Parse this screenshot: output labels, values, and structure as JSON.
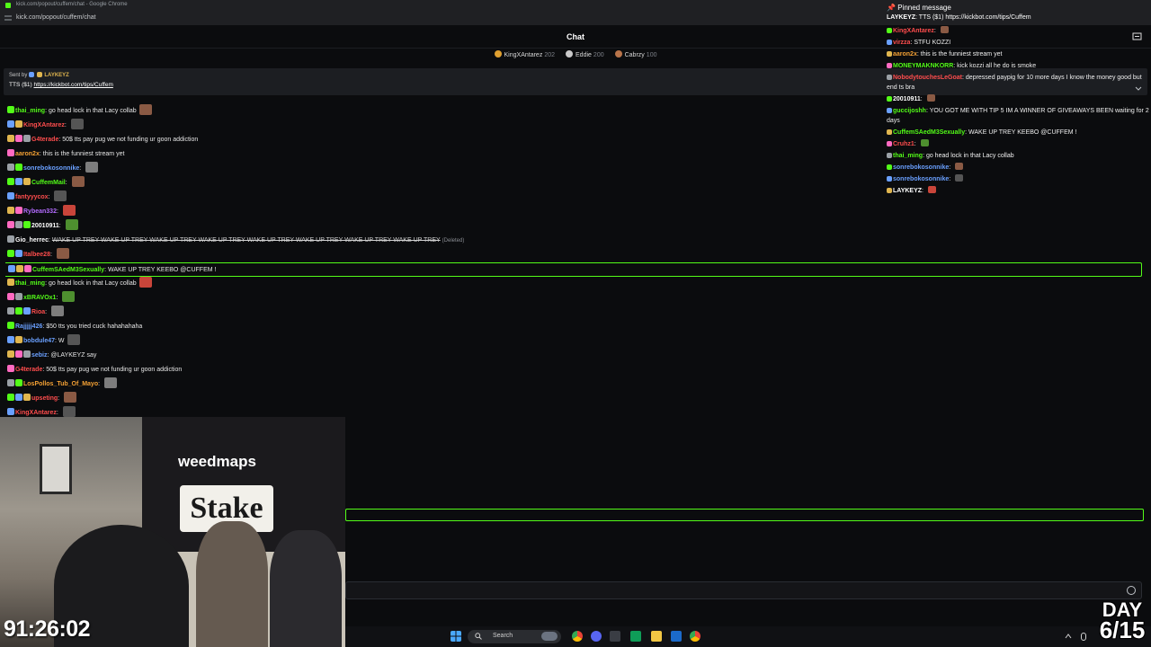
{
  "browser": {
    "title": "kick.com/popout/cuffem/chat - Google Chrome",
    "url": "kick.com/popout/cuffem/chat"
  },
  "chat_header": {
    "title": "Chat"
  },
  "top_gifters": [
    {
      "name": "KingXAntarez",
      "count": "202",
      "color": "#e0a030"
    },
    {
      "name": "Eddie",
      "count": "200",
      "color": "#c9c9c9"
    },
    {
      "name": "Cabrzy",
      "count": "100",
      "color": "#b8744a"
    }
  ],
  "tts": {
    "sent_by_label": "Sent by",
    "sender": "LAYKEYZ",
    "message": "TTS ($1)",
    "link": "https://kickbot.com/tips/Cuffem"
  },
  "messages": [
    {
      "user": "thai_ming",
      "color": "#53fc18",
      "text": "go head lock in that Lacy collab",
      "deleted": false
    },
    {
      "user": "KingXAntarez",
      "color": "#ff4d4d",
      "text": "",
      "deleted": false
    },
    {
      "user": "G4terade",
      "color": "#ff4d4d",
      "text": "50$ tts pay pug we not funding ur goon addiction",
      "deleted": false
    },
    {
      "user": "aaron2x",
      "color": "#f4a134",
      "text": "this is the funniest stream yet",
      "deleted": false
    },
    {
      "user": "sonrebokosonnike",
      "color": "#6aa0ff",
      "text": "",
      "deleted": false
    },
    {
      "user": "CuffemMail",
      "color": "#53fc18",
      "text": "",
      "deleted": false
    },
    {
      "user": "fantyyycox",
      "color": "#ff4d4d",
      "text": "",
      "deleted": false
    },
    {
      "user": "Rybean332",
      "color": "#b36bff",
      "text": "",
      "deleted": false
    },
    {
      "user": "20010911",
      "color": "#ffffff",
      "text": "",
      "deleted": false
    },
    {
      "user": "Gio_herrec",
      "color": "#ffffff",
      "text": "WAKE UP TREY WAKE UP TREY WAKE UP TREY WAKE UP TREY WAKE UP TREY WAKE UP TREY WAKE UP TREY WAKE UP TREY",
      "deleted": true,
      "deleted_tag": "(Deleted)"
    },
    {
      "user": "Italbee28",
      "color": "#ff4d4d",
      "text": "",
      "deleted": false
    },
    {
      "user": "CuffemSAedM3Sexually",
      "color": "#53fc18",
      "text": "WAKE UP TREY KEEBO @CUFFEM !",
      "deleted": false,
      "highlight": true
    },
    {
      "user": "thai_ming",
      "color": "#53fc18",
      "text": "go head lock in that Lacy collab",
      "deleted": false
    },
    {
      "user": "xBRAVOx1",
      "color": "#53fc18",
      "text": "",
      "deleted": false
    },
    {
      "user": "Rioa",
      "color": "#ff4d4d",
      "text": "",
      "deleted": false
    },
    {
      "user": "Rajjjjj426",
      "color": "#6aa0ff",
      "text": "$50 tts you tried cuck hahahahaha",
      "deleted": false
    },
    {
      "user": "bobdule47",
      "color": "#6aa0ff",
      "text": "W",
      "deleted": false
    },
    {
      "user": "sebiz",
      "color": "#6aa0ff",
      "text": "@LAYKEYZ say",
      "deleted": false
    },
    {
      "user": "G4terade",
      "color": "#ff4d4d",
      "text": "50$ tts pay pug we not funding ur goon addiction",
      "deleted": false
    },
    {
      "user": "LosPollos_Tub_Of_Mayo",
      "color": "#f4a134",
      "text": "",
      "deleted": false
    },
    {
      "user": "upseting",
      "color": "#ff4d4d",
      "text": "",
      "deleted": false
    },
    {
      "user": "KingXAntarez",
      "color": "#ff4d4d",
      "text": "",
      "deleted": false
    }
  ],
  "overlay": {
    "pinned_title": "Pinned message",
    "pinned_user": "LAYKEYZ",
    "pinned_text": "TTS ($1) https://kickbot.com/tips/Cuffem",
    "messages": [
      {
        "user": "KingXAntarez",
        "color": "#ff4d4d",
        "text": ""
      },
      {
        "user": "virzza",
        "color": "#ff4d4d",
        "text": "STFU KOZZI"
      },
      {
        "user": "aaron2x",
        "color": "#f4a134",
        "text": "this is the funniest stream yet"
      },
      {
        "user": "MONEYMAKNKORR",
        "color": "#53fc18",
        "text": "kick kozzi all he do is smoke"
      },
      {
        "user": "NobodytouchesLeGoat",
        "color": "#ff4d4d",
        "text": "depressed paypig for 10 more days I know the money good but end ts bra",
        "wrap": true
      },
      {
        "user": "20010911",
        "color": "#ffffff",
        "text": ""
      },
      {
        "user": "guccijoshh",
        "color": "#53fc18",
        "text": "YOU GOT ME WITH TIP 5 IM A WINNER OF GIVEAWAYS BEEN waiting for 2 days",
        "wrap": true
      },
      {
        "user": "CuffemSAedM3Sexually",
        "color": "#53fc18",
        "text": "WAKE UP TREY KEEBO @CUFFEM !"
      },
      {
        "user": "Cruhz1",
        "color": "#ff4d4d",
        "text": ""
      },
      {
        "user": "thai_ming",
        "color": "#53fc18",
        "text": "go head lock in that Lacy collab"
      },
      {
        "user": "sonrebokosonnike",
        "color": "#6aa0ff",
        "text": ""
      },
      {
        "user": "sonrebokosonnike",
        "color": "#6aa0ff",
        "text": ""
      },
      {
        "user": "LAYKEYZ",
        "color": "#ffffff",
        "text": ""
      }
    ]
  },
  "taskbar": {
    "search_label": "Search"
  },
  "stream": {
    "timer": "91:26:02",
    "day_label": "DAY",
    "day_value": "6/15",
    "banner_text": "weedmaps",
    "stake_text": "Stake"
  }
}
